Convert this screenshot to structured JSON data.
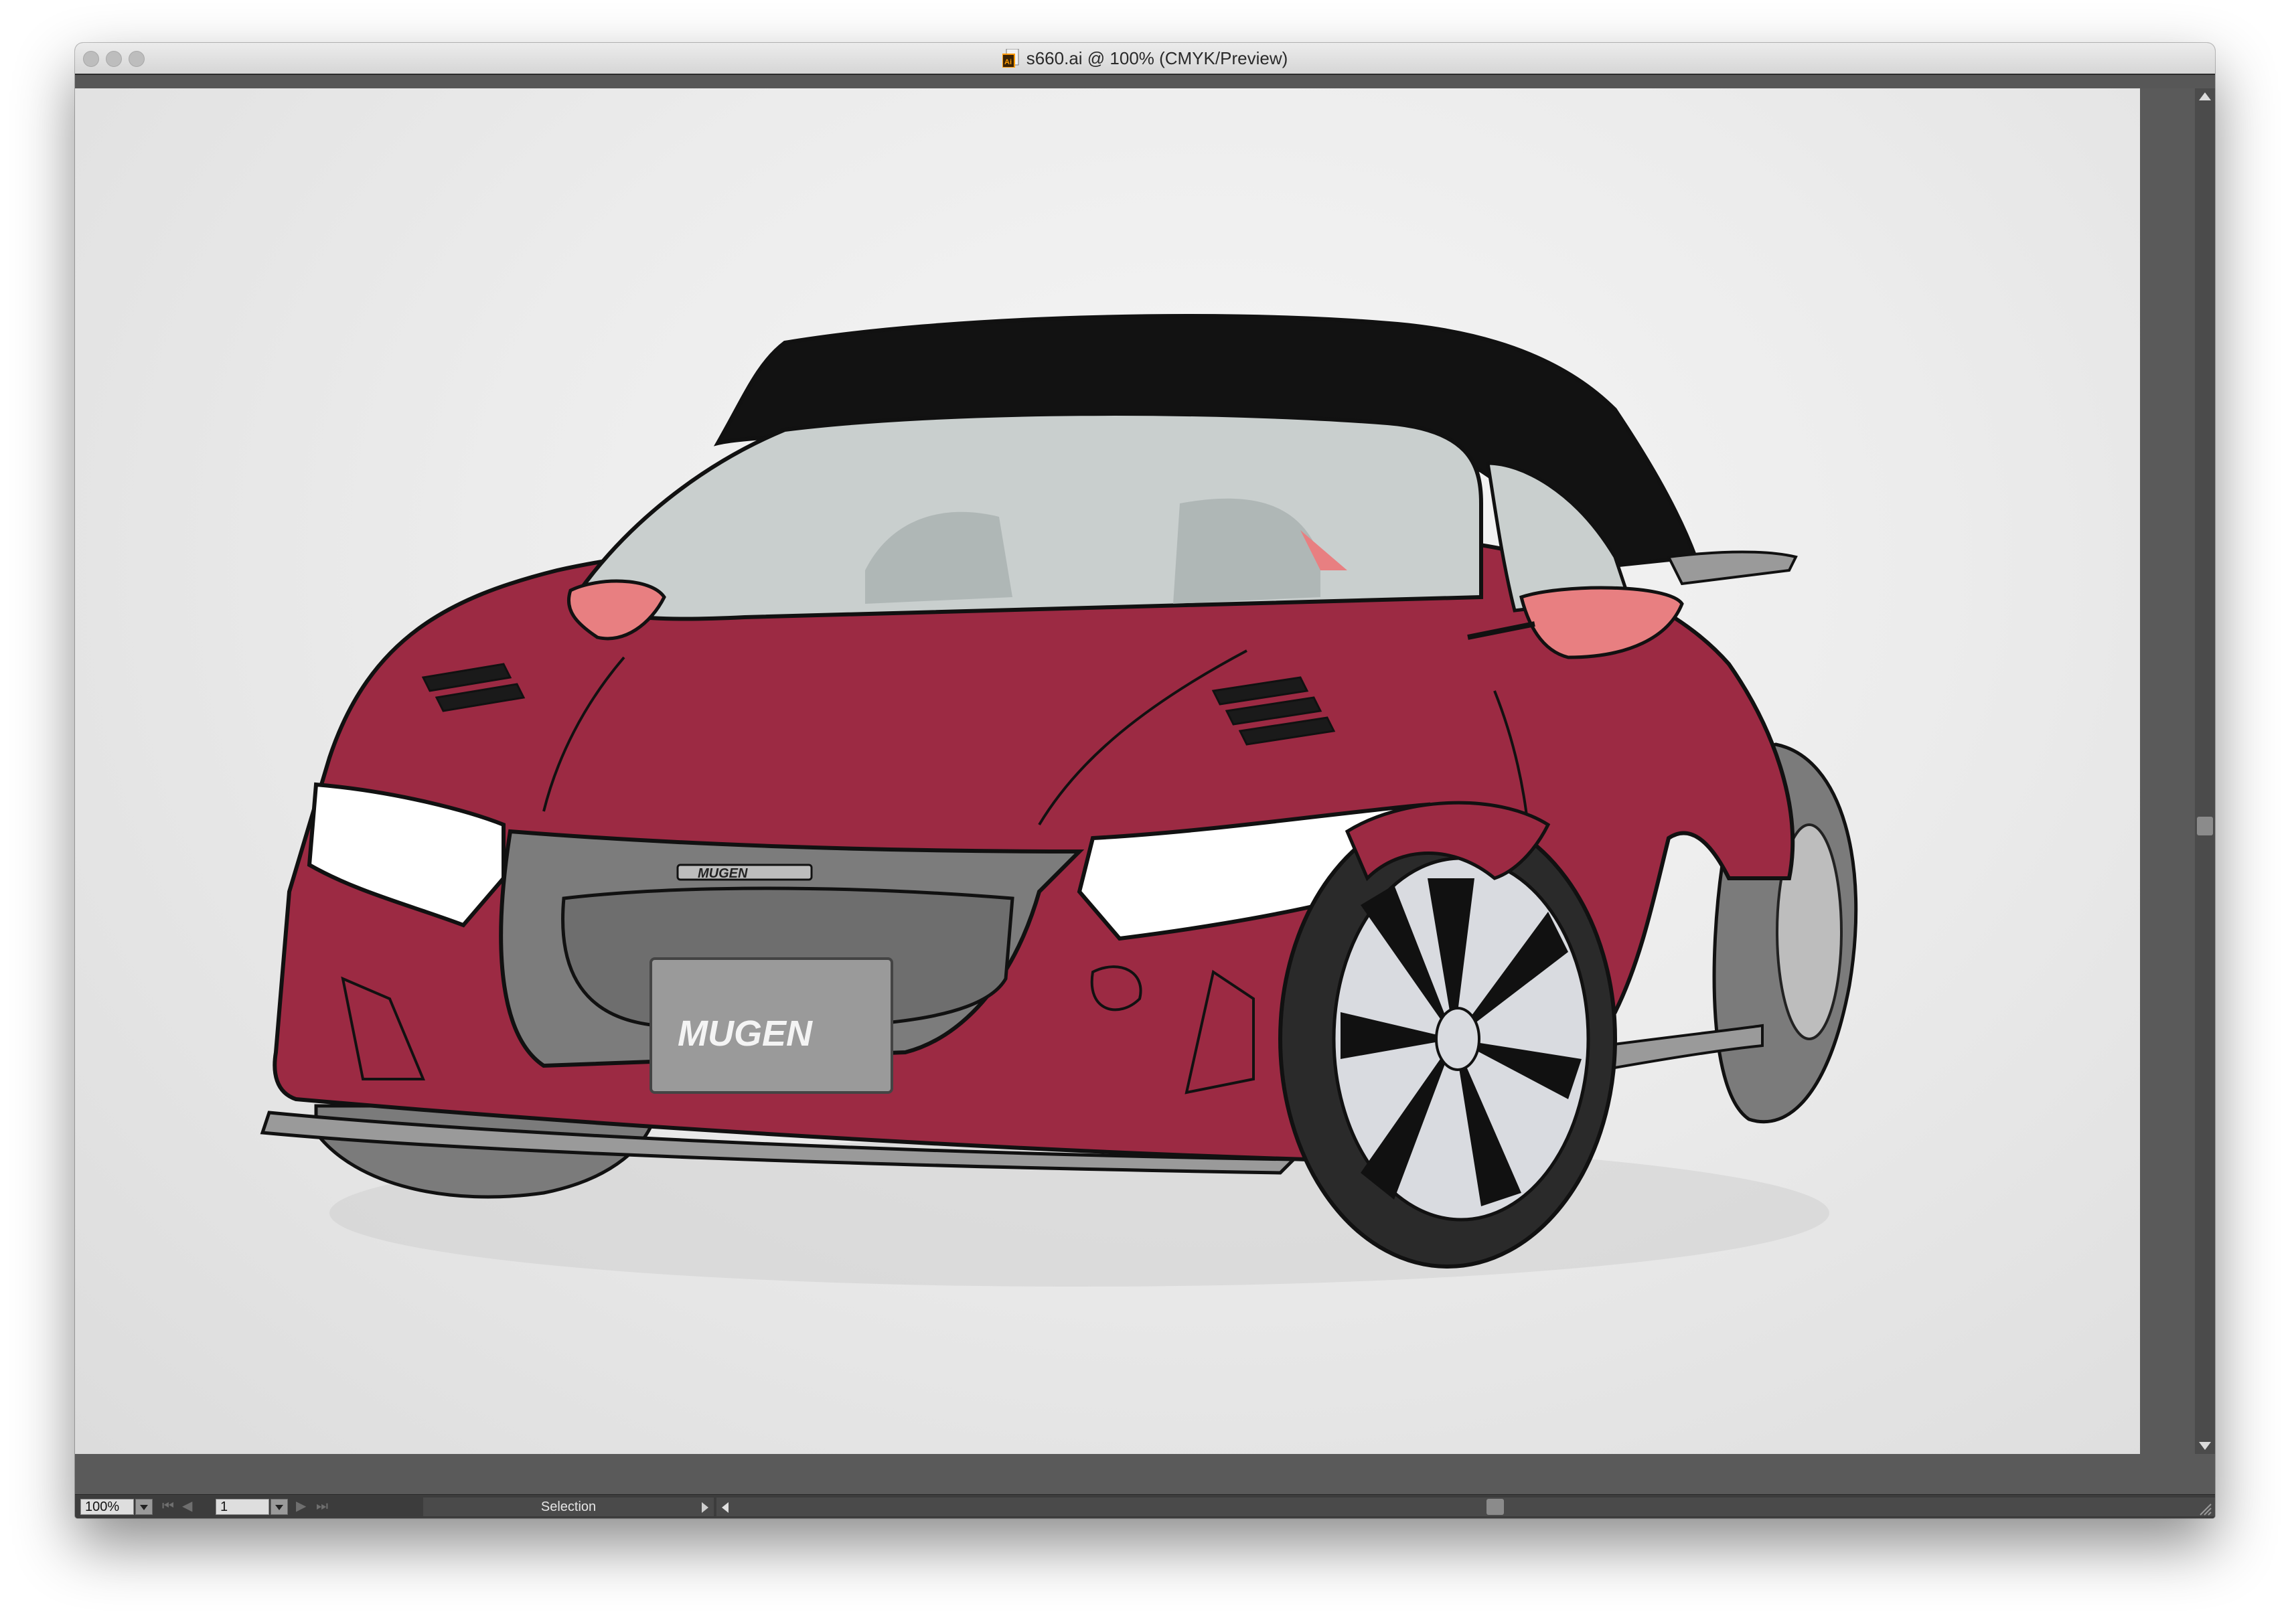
{
  "window": {
    "title": "s660.ai @ 100% (CMYK/Preview)",
    "doc_icon": "illustrator-document-icon"
  },
  "artwork": {
    "subject": "red sports car line illustration",
    "badge_text": "MUGEN",
    "plate_text": "MUGEN",
    "colors": {
      "body": "#9c2a43",
      "roof": "#121212",
      "glass": "#c9cfce",
      "trim": "#7c7c7c",
      "headlight": "#ffffff",
      "mirror": "#e87f81",
      "outline": "#111111"
    }
  },
  "statusbar": {
    "zoom": "100%",
    "page": "1",
    "tool": "Selection"
  },
  "scrollbars": {
    "vertical_position": 0.52,
    "horizontal_position": 0.5
  }
}
